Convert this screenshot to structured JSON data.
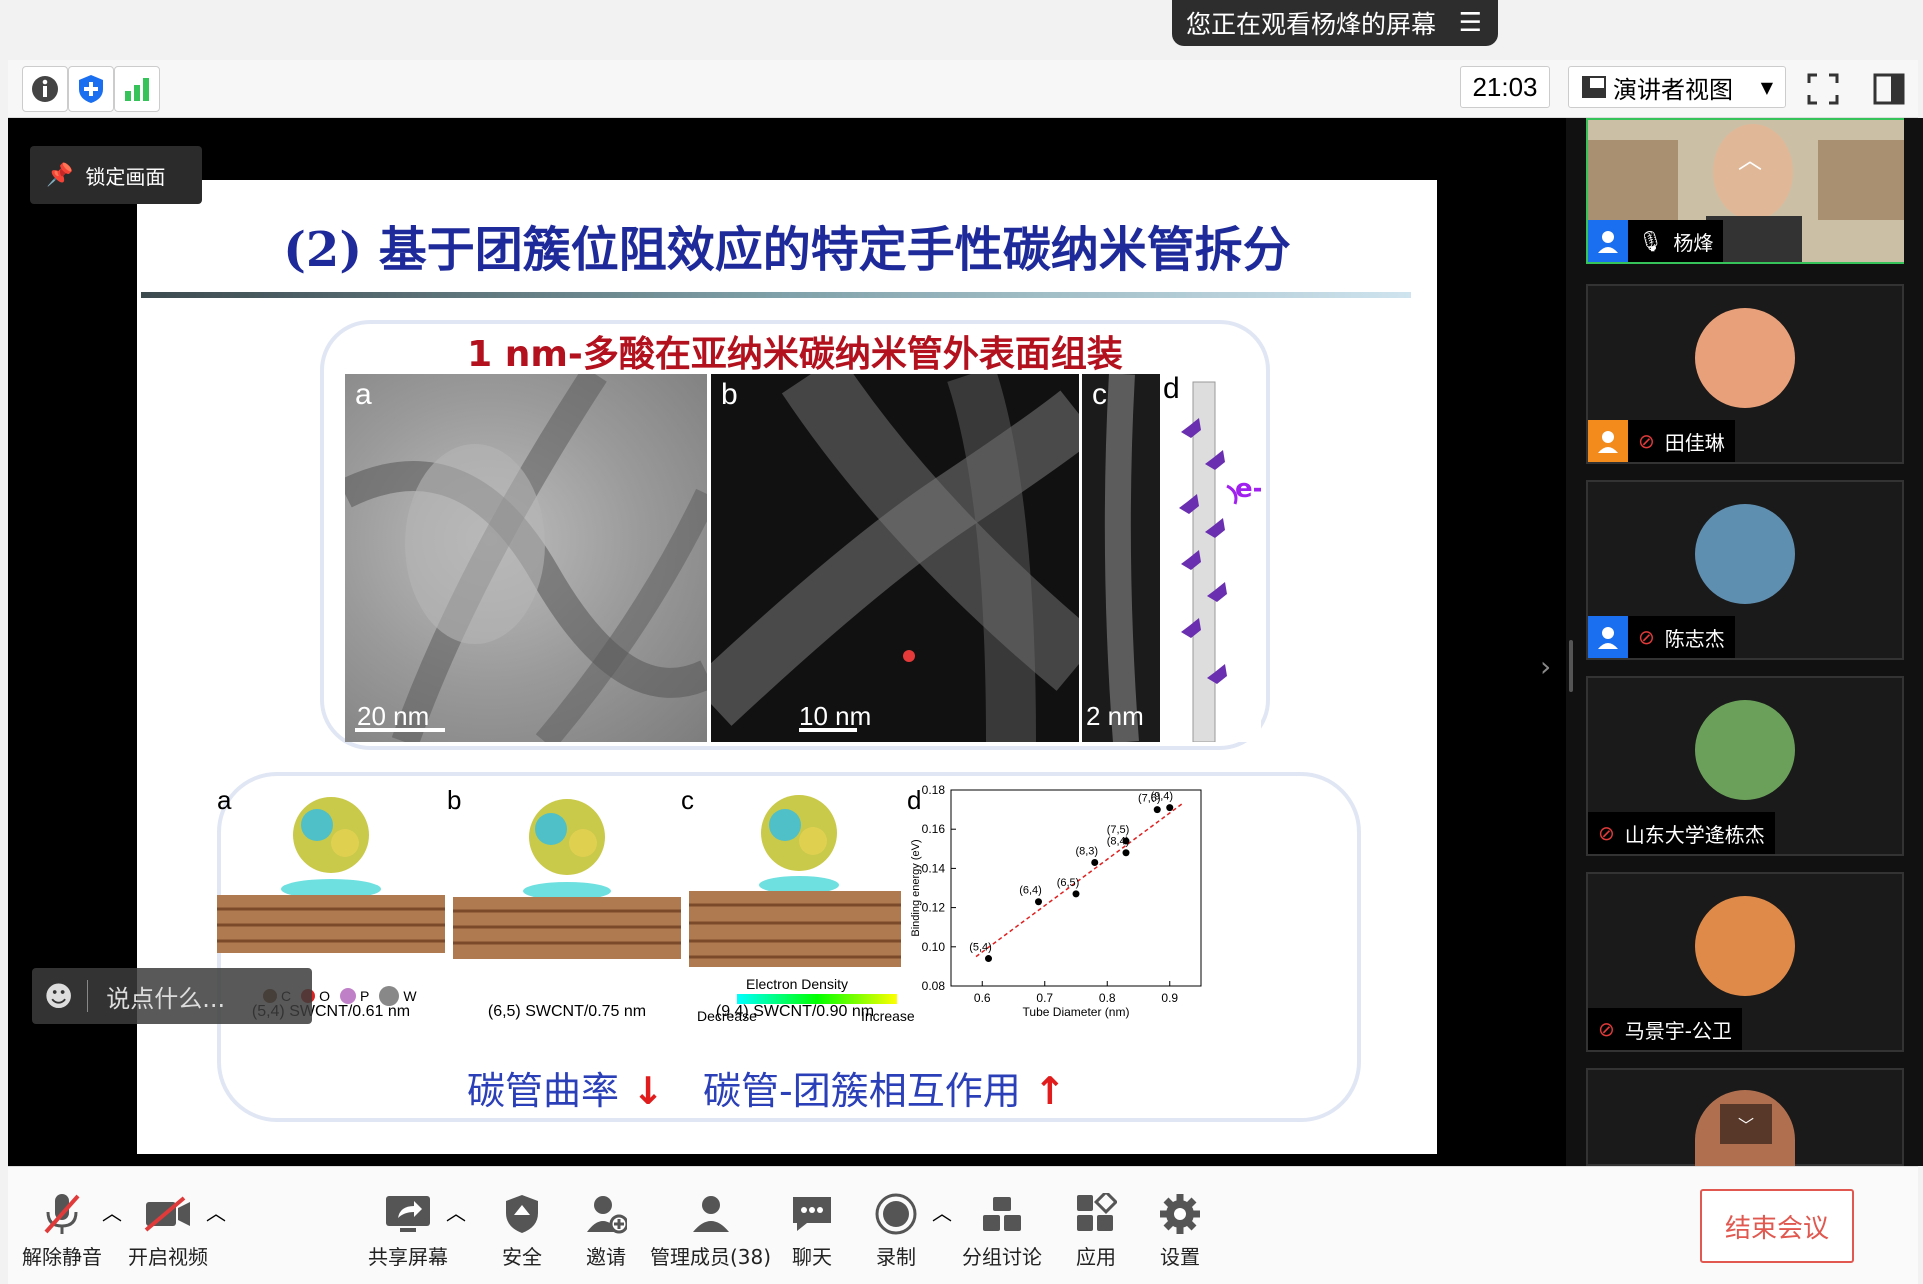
{
  "banner": {
    "text": "您正在观看杨烽的屏幕",
    "menu_icon": "list-icon"
  },
  "topbar": {
    "timer": "21:03",
    "view_mode": "演讲者视图"
  },
  "lock_button": {
    "label": "锁定画面"
  },
  "comment_box": {
    "placeholder": "说点什么..."
  },
  "slide": {
    "title": "(2) 基于团簇位阻效应的特定手性碳纳米管拆分",
    "box1_title": "1 nm-多酸在亚纳米碳纳米管外表面组装",
    "panels_top": [
      {
        "label": "a",
        "scale": "20 nm"
      },
      {
        "label": "b",
        "scale": "10 nm"
      },
      {
        "label": "c",
        "scale": "2 nm"
      },
      {
        "label": "d",
        "annotation": "e-"
      }
    ],
    "panels_bottom": [
      {
        "label": "a",
        "caption": "(5,4) SWCNT/0.61 nm"
      },
      {
        "label": "b",
        "caption": "(6,5) SWCNT/0.75 nm"
      },
      {
        "label": "c",
        "caption": "(9,4) SWCNT/0.90 nm"
      },
      {
        "label": "d"
      }
    ],
    "legend_atoms": [
      "C",
      "O",
      "P",
      "W"
    ],
    "density": {
      "title": "Electron Density",
      "low": "Decrease",
      "high": "Increase"
    },
    "caption_left": "碳管曲率",
    "caption_right": "碳管-团簇相互作用"
  },
  "chart_data": {
    "type": "scatter",
    "xlabel": "Tube Diameter (nm)",
    "ylabel": "Binding energy (eV)",
    "xlim": [
      0.55,
      0.95
    ],
    "ylim": [
      0.08,
      0.18
    ],
    "xticks": [
      "0.6",
      "0.7",
      "0.8",
      "0.9"
    ],
    "yticks": [
      "0.08",
      "0.10",
      "0.12",
      "0.14",
      "0.16",
      "0.18"
    ],
    "points": [
      {
        "label": "(5,4)",
        "x": 0.61,
        "y": 0.094
      },
      {
        "label": "(6,4)",
        "x": 0.69,
        "y": 0.123
      },
      {
        "label": "(6,5)",
        "x": 0.75,
        "y": 0.127
      },
      {
        "label": "(8,3)",
        "x": 0.78,
        "y": 0.143
      },
      {
        "label": "(7,5)",
        "x": 0.83,
        "y": 0.154
      },
      {
        "label": "(8,4)",
        "x": 0.83,
        "y": 0.148
      },
      {
        "label": "(7,6)",
        "x": 0.88,
        "y": 0.17
      },
      {
        "label": "(9,4)",
        "x": 0.9,
        "y": 0.171
      }
    ],
    "fit_line": {
      "from": [
        0.59,
        0.095
      ],
      "to": [
        0.92,
        0.173
      ]
    }
  },
  "participants": [
    {
      "name": "杨烽",
      "mic": "on",
      "role": "presenter"
    },
    {
      "name": "田佳琳",
      "mic": "muted",
      "avatar_color": "#e8a07a"
    },
    {
      "name": "陈志杰",
      "mic": "muted",
      "avatar_color": "#5f8fb0"
    },
    {
      "name": "山东大学逄栋杰",
      "mic": "muted",
      "avatar_color": "#6aa05a"
    },
    {
      "name": "马景宇-公卫",
      "mic": "muted",
      "avatar_color": "#e08a4a"
    }
  ],
  "bottombar": {
    "unmute": "解除静音",
    "video": "开启视频",
    "share": "共享屏幕",
    "security": "安全",
    "invite": "邀请",
    "members": "管理成员(38)",
    "chat": "聊天",
    "record": "录制",
    "breakout": "分组讨论",
    "apps": "应用",
    "settings": "设置",
    "end": "结束会议"
  },
  "colors": {
    "accent": "#1e2a9a",
    "end_red": "#e0584f",
    "active_green": "#35c35a"
  }
}
